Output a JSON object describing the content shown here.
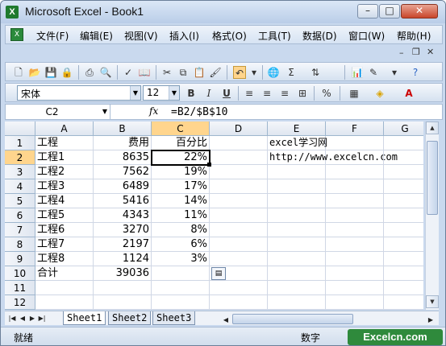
{
  "window": {
    "title": "Microsoft Excel - Book1",
    "app_icon": "excel-icon"
  },
  "menu": {
    "items": [
      "文件(F)",
      "编辑(E)",
      "视图(V)",
      "插入(I)",
      "格式(O)",
      "工具(T)",
      "数据(D)",
      "窗口(W)",
      "帮助(H)"
    ]
  },
  "format_toolbar": {
    "font_name": "宋体",
    "font_size": "12",
    "bold": "B",
    "italic": "I",
    "underline": "U"
  },
  "formula_bar": {
    "name_box": "C2",
    "fx": "fx",
    "formula": "=B2/$B$10"
  },
  "columns": [
    "A",
    "B",
    "C",
    "D",
    "E",
    "F",
    "G"
  ],
  "rows": [
    "1",
    "2",
    "3",
    "4",
    "5",
    "6",
    "7",
    "8",
    "9",
    "10",
    "11",
    "12"
  ],
  "cells": {
    "A1": "工程",
    "B1": "费用",
    "C1": "百分比",
    "E1": "excel学习网",
    "A2": "工程1",
    "B2": "8635",
    "C2": "22%",
    "E2": "http://www.excelcn.com",
    "A3": "工程2",
    "B3": "7562",
    "C3": "19%",
    "A4": "工程3",
    "B4": "6489",
    "C4": "17%",
    "A5": "工程4",
    "B5": "5416",
    "C5": "14%",
    "A6": "工程5",
    "B6": "4343",
    "C6": "11%",
    "A7": "工程6",
    "B7": "3270",
    "C7": "8%",
    "A8": "工程7",
    "B8": "2197",
    "C8": "6%",
    "A9": "工程8",
    "B9": "1124",
    "C9": "3%",
    "A10": "合计",
    "B10": "39036"
  },
  "sheet_tabs": [
    "Sheet1",
    "Sheet2",
    "Sheet3"
  ],
  "active_sheet": "Sheet1",
  "status": {
    "left": "就绪",
    "mode": "数字"
  },
  "watermark": "Excelcn.com",
  "colors": {
    "accent": "#ffd58d",
    "frame": "#c9d9ee"
  }
}
